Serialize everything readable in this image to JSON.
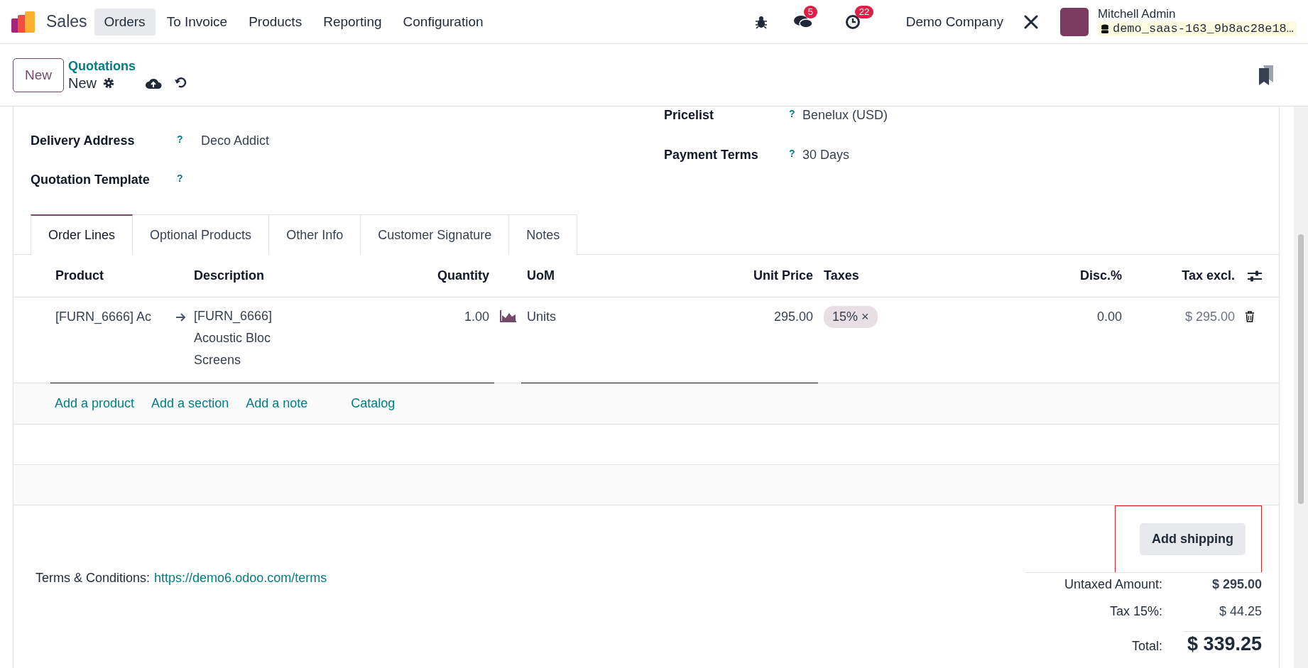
{
  "navbar": {
    "app_name": "Sales",
    "menu": [
      {
        "label": "Orders",
        "selected": true
      },
      {
        "label": "To Invoice",
        "selected": false
      },
      {
        "label": "Products",
        "selected": false
      },
      {
        "label": "Reporting",
        "selected": false
      },
      {
        "label": "Configuration",
        "selected": false
      }
    ],
    "messages_badge": "5",
    "activities_badge": "22",
    "company": "Demo Company",
    "user_name": "Mitchell Admin",
    "database": "demo_saas-163_9b8ac28e18…"
  },
  "control_panel": {
    "new_button": "New",
    "breadcrumb": "Quotations",
    "record": "New"
  },
  "fields_left": [
    {
      "label": "Delivery Address",
      "help": "?",
      "value": "Deco Addict"
    },
    {
      "label": "Quotation Template",
      "help": "?"
    }
  ],
  "fields_right": [
    {
      "label": "Pricelist",
      "help": "?",
      "value": "Benelux (USD)"
    },
    {
      "label": "Payment Terms",
      "help": "?",
      "value": "30 Days"
    }
  ],
  "tabs": [
    {
      "label": "Order Lines",
      "selected": true
    },
    {
      "label": "Optional Products",
      "selected": false
    },
    {
      "label": "Other Info",
      "selected": false
    },
    {
      "label": "Customer Signature",
      "selected": false
    },
    {
      "label": "Notes",
      "selected": false
    }
  ],
  "table": {
    "columns": [
      "Product",
      "Description",
      "Quantity",
      "UoM",
      "Unit Price",
      "Taxes",
      "Disc.%",
      "Tax excl."
    ],
    "rows": [
      {
        "product": "[FURN_6666] Ac",
        "description": "[FURN_6666] Acoustic Bloc Screens",
        "quantity": "1.00",
        "uom": "Units",
        "unit_price": "295.00",
        "tax": "15%",
        "tax_remove": "×",
        "discount": "0.00",
        "subtotal": "$ 295.00"
      }
    ],
    "add_links": [
      "Add a product",
      "Add a section",
      "Add a note",
      "Catalog"
    ]
  },
  "shipping_button": {
    "label": "Add shipping",
    "highlighted": true
  },
  "terms": {
    "label": "Terms & Conditions:",
    "link": "https://demo6.odoo.com/terms"
  },
  "totals": [
    {
      "label": "Untaxed Amount:",
      "value": "$ 295.00",
      "kind": "bold"
    },
    {
      "label": "Tax 15%:",
      "value": "$ 44.25",
      "kind": "plain"
    },
    {
      "label": "Total:",
      "value": "$ 339.25",
      "kind": "grand"
    }
  ]
}
